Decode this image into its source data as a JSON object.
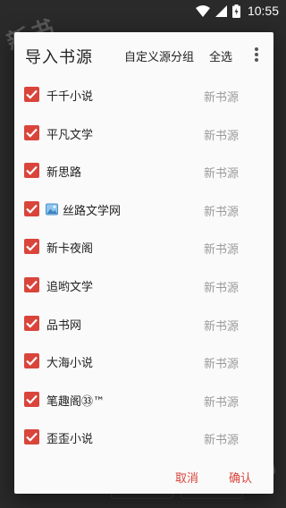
{
  "status_bar": {
    "time": "10:55",
    "icons": [
      "wifi-icon",
      "signal-icon",
      "battery-charging-icon"
    ]
  },
  "background": {
    "watermark_text": "新书"
  },
  "dialog": {
    "title": "导入书源",
    "actions": {
      "custom_group": "自定义源分组",
      "select_all": "全选",
      "more_icon": "more-vert-icon"
    },
    "sources": [
      {
        "name": "千千小说",
        "tag": "新书源",
        "checked": true,
        "icon": null
      },
      {
        "name": "平凡文学",
        "tag": "新书源",
        "checked": true,
        "icon": null
      },
      {
        "name": "新思路",
        "tag": "新书源",
        "checked": true,
        "icon": null
      },
      {
        "name": "丝路文学网",
        "tag": "新书源",
        "checked": true,
        "icon": "image-emoji-icon"
      },
      {
        "name": "新卡夜阁",
        "tag": "新书源",
        "checked": true,
        "icon": null
      },
      {
        "name": "追哟文学",
        "tag": "新书源",
        "checked": true,
        "icon": null
      },
      {
        "name": "品书网",
        "tag": "新书源",
        "checked": true,
        "icon": null
      },
      {
        "name": "大海小说",
        "tag": "新书源",
        "checked": true,
        "icon": null
      },
      {
        "name": "笔趣阁㉝™",
        "tag": "新书源",
        "checked": true,
        "icon": null
      },
      {
        "name": "歪歪小说",
        "tag": "新书源",
        "checked": true,
        "icon": null
      }
    ],
    "buttons": {
      "cancel": "取消",
      "confirm": "确认"
    },
    "colors": {
      "accent": "#d9453b",
      "tag_text": "#9a9a9a"
    }
  }
}
